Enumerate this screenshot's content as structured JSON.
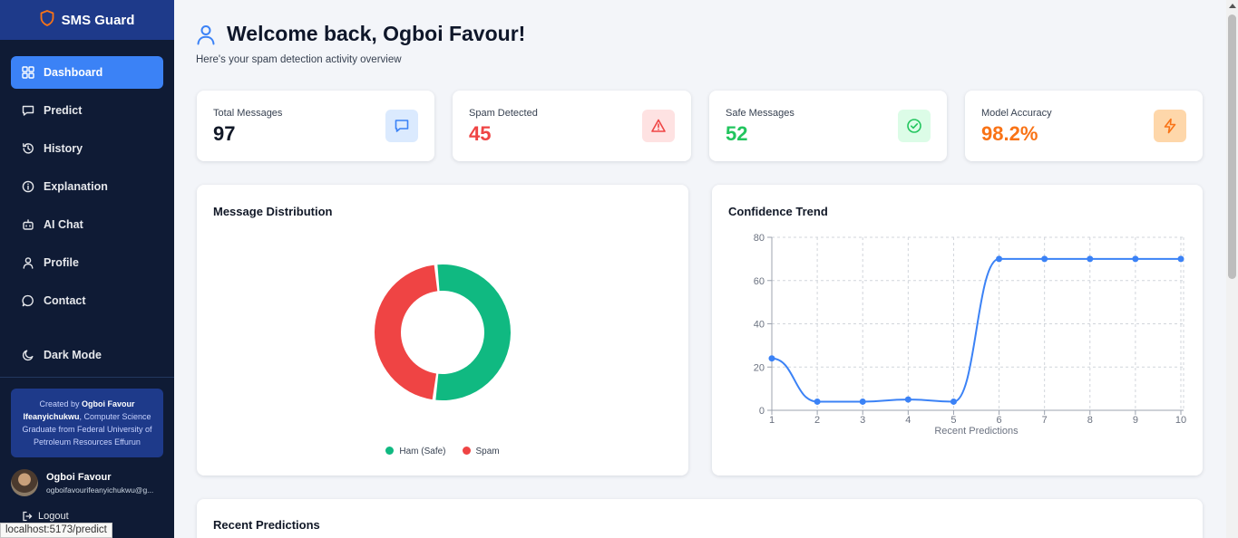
{
  "app": {
    "title": "SMS Guard"
  },
  "nav": {
    "items": [
      {
        "label": "Dashboard",
        "icon": "dashboard-grid-icon",
        "active": true
      },
      {
        "label": "Predict",
        "icon": "message-square-icon"
      },
      {
        "label": "History",
        "icon": "history-icon"
      },
      {
        "label": "Explanation",
        "icon": "info-icon"
      },
      {
        "label": "AI Chat",
        "icon": "bot-icon"
      },
      {
        "label": "Profile",
        "icon": "user-icon"
      },
      {
        "label": "Contact",
        "icon": "message-circle-icon"
      }
    ],
    "dark_mode": "Dark Mode"
  },
  "credit": {
    "prefix": "Created by ",
    "name": "Ogboi Favour Ifeanyichukwu",
    "suffix": ", Computer Science Graduate from Federal University of Petroleum Resources Effurun"
  },
  "user": {
    "name": "Ogboi Favour",
    "email": "ogboifavourifeanyichukwu@g..."
  },
  "logout": "Logout",
  "status_url": "localhost:5173/predict",
  "header": {
    "title": "Welcome back, Ogboi Favour!",
    "subtitle": "Here's your spam detection activity overview"
  },
  "stats": [
    {
      "label": "Total Messages",
      "value": "97",
      "color": "#111827",
      "icon": "message-square-icon",
      "icon_bg": "#dbeafe",
      "icon_color": "#3b82f6"
    },
    {
      "label": "Spam Detected",
      "value": "45",
      "color": "#ef4444",
      "icon": "alert-triangle-icon",
      "icon_bg": "#fee2e2",
      "icon_color": "#ef4444"
    },
    {
      "label": "Safe Messages",
      "value": "52",
      "color": "#22c55e",
      "icon": "check-circle-icon",
      "icon_bg": "#dcfce7",
      "icon_color": "#22c55e"
    },
    {
      "label": "Model Accuracy",
      "value": "98.2%",
      "color": "#f97316",
      "icon": "zap-icon",
      "icon_bg": "#fed7aa",
      "icon_color": "#f97316"
    }
  ],
  "distribution": {
    "title": "Message Distribution",
    "legend": [
      {
        "label": "Ham (Safe)",
        "color": "#10b981"
      },
      {
        "label": "Spam",
        "color": "#ef4444"
      }
    ]
  },
  "trend": {
    "title": "Confidence Trend"
  },
  "recent": {
    "title": "Recent Predictions"
  },
  "chart_data": [
    {
      "type": "pie",
      "title": "Message Distribution",
      "labels": [
        "Ham (Safe)",
        "Spam"
      ],
      "values": [
        52,
        45
      ],
      "colors": [
        "#10b981",
        "#ef4444"
      ]
    },
    {
      "type": "line",
      "title": "Confidence Trend",
      "xlabel": "Recent Predictions",
      "ylabel": "",
      "x": [
        1,
        2,
        3,
        4,
        5,
        6,
        7,
        8,
        9,
        10
      ],
      "series": [
        {
          "values": [
            24,
            4,
            4,
            5,
            4,
            70,
            70,
            70,
            70,
            70
          ],
          "color": "#3b82f6"
        }
      ],
      "xlim": [
        1,
        10
      ],
      "ylim": [
        0,
        80
      ],
      "yticks": [
        0,
        20,
        40,
        60,
        80
      ],
      "grid": true
    }
  ]
}
